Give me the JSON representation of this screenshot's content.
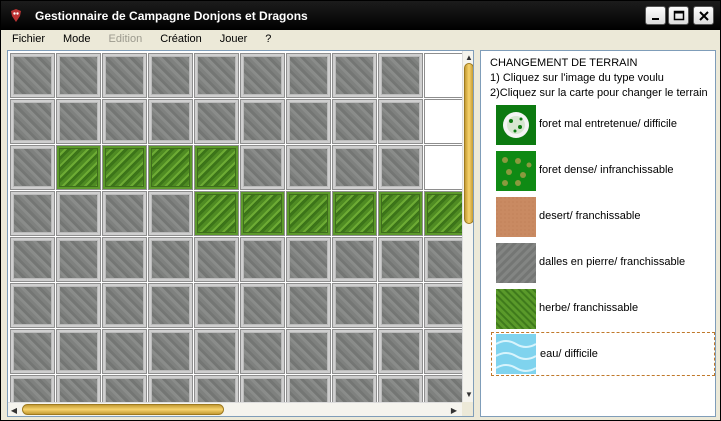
{
  "window": {
    "title": "Gestionnaire de Campagne Donjons et Dragons"
  },
  "menu": [
    "Fichier",
    "Mode",
    "Edition",
    "Création",
    "Jouer",
    "?"
  ],
  "menu_disabled": [
    false,
    false,
    true,
    false,
    false,
    false
  ],
  "map": {
    "rows": [
      [
        "stone",
        "stone",
        "stone",
        "stone",
        "stone",
        "stone",
        "stone",
        "stone",
        "stone",
        "white"
      ],
      [
        "stone",
        "stone",
        "stone",
        "stone",
        "stone",
        "stone",
        "stone",
        "stone",
        "stone",
        "white"
      ],
      [
        "stone",
        "grass",
        "grass",
        "grass",
        "grass",
        "stone",
        "stone",
        "stone",
        "stone",
        "white"
      ],
      [
        "stone",
        "stone",
        "stone",
        "stone",
        "grass",
        "grass",
        "grass",
        "grass",
        "grass",
        "grass"
      ],
      [
        "stone",
        "stone",
        "stone",
        "stone",
        "stone",
        "stone",
        "stone",
        "stone",
        "stone",
        "stone"
      ],
      [
        "stone",
        "stone",
        "stone",
        "stone",
        "stone",
        "stone",
        "stone",
        "stone",
        "stone",
        "stone"
      ],
      [
        "stone",
        "stone",
        "stone",
        "stone",
        "stone",
        "stone",
        "stone",
        "stone",
        "stone",
        "stone"
      ],
      [
        "stone",
        "stone",
        "stone",
        "stone",
        "stone",
        "stone",
        "stone",
        "stone",
        "stone",
        "stone"
      ]
    ]
  },
  "side": {
    "heading": "CHANGEMENT DE TERRAIN",
    "step1": "1) Cliquez sur l'image du type voulu",
    "step2": "2)Cliquez sur la carte pour changer le terrain",
    "terrains": [
      {
        "label": "foret mal entretenue/ difficile",
        "icon": "bush-icon"
      },
      {
        "label": "foret dense/ infranchissable",
        "icon": "dense-forest-icon"
      },
      {
        "label": "desert/ franchissable",
        "icon": "desert-icon"
      },
      {
        "label": "dalles en pierre/ franchissable",
        "icon": "stone-slab-icon"
      },
      {
        "label": "herbe/ franchissable",
        "icon": "grass-icon"
      },
      {
        "label": "eau/ difficile",
        "icon": "water-icon"
      }
    ],
    "selected_index": 5
  }
}
